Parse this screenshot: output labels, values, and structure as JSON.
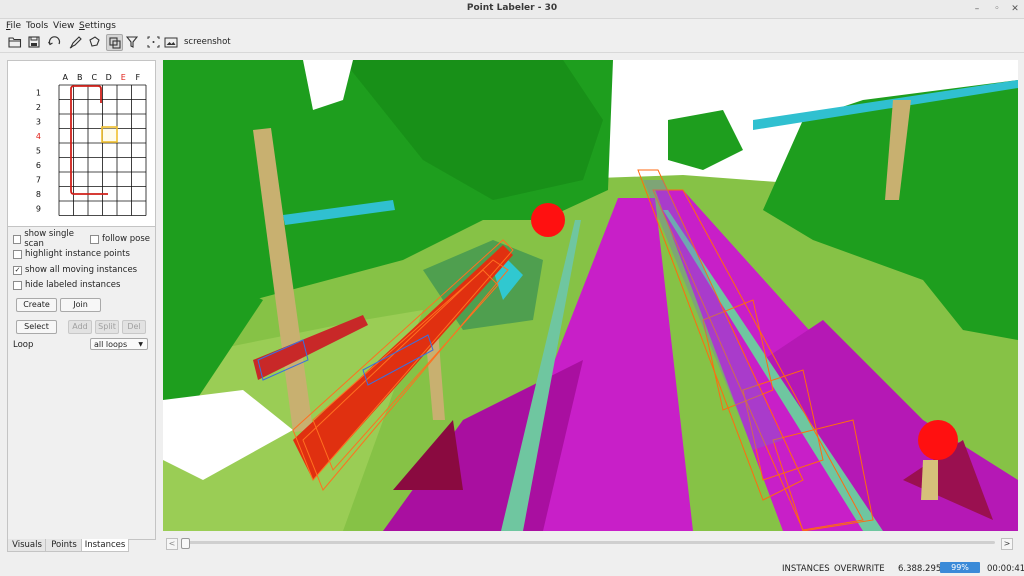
{
  "window": {
    "title": "Point Labeler - 30"
  },
  "menu": {
    "items": [
      {
        "label": "File",
        "accel": "F",
        "rest": "ile"
      },
      {
        "label": "Tools",
        "accel": "",
        "rest": "Tools"
      },
      {
        "label": "View",
        "accel": "",
        "rest": "View"
      },
      {
        "label": "Settings",
        "accel": "S",
        "rest": "ettings"
      }
    ]
  },
  "toolbar": {
    "screenshot_label": "screenshot"
  },
  "grid": {
    "columns": [
      "A",
      "B",
      "C",
      "D",
      "E",
      "F"
    ],
    "rows": [
      "1",
      "2",
      "3",
      "4",
      "5",
      "6",
      "7",
      "8",
      "9"
    ],
    "highlight_column": "E",
    "highlight_row": "4",
    "highlight_color": "#e0201a"
  },
  "options": {
    "show_single_scan": {
      "label": "show single scan",
      "checked": false
    },
    "follow_pose": {
      "label": "follow pose",
      "checked": false
    },
    "highlight_instance_points": {
      "label": "highlight instance points",
      "checked": false
    },
    "show_all_moving_instances": {
      "label": "show all moving instances",
      "checked": true
    },
    "hide_labeled_instances": {
      "label": "hide labeled instances",
      "checked": false
    }
  },
  "buttons": {
    "create": "Create",
    "join": "Join",
    "select": "Select",
    "add": "Add",
    "split": "Split",
    "del": "Del"
  },
  "loop": {
    "label": "Loop",
    "value": "all loops"
  },
  "tabs": [
    {
      "label": "Visuals",
      "selected": false
    },
    {
      "label": "Points",
      "selected": false
    },
    {
      "label": "Instances",
      "selected": true
    }
  ],
  "status": {
    "mode": "INSTANCES",
    "overwrite": "OVERWRITE",
    "count": "6.388.295",
    "progress": "99%",
    "progress_value": 0.99,
    "time": "00:00:41"
  },
  "colors": {
    "vegetation": "#1e9e1e",
    "terrain": "#7fbf3f",
    "road": "#c81fc8",
    "trunk": "#c8b070",
    "car": "#ff2a12",
    "box": "#ff6a10",
    "pole": "#30c8d0",
    "lane": "#70c8a0",
    "progress": "#3a8ad8"
  }
}
